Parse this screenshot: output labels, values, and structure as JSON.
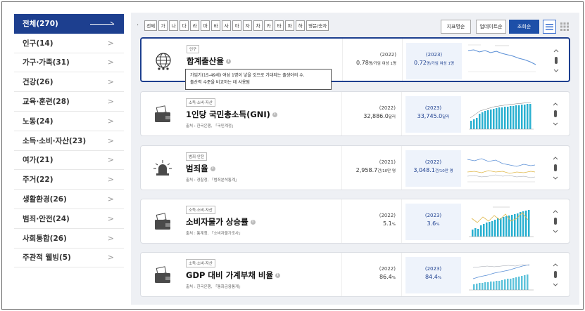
{
  "sidebar": {
    "items": [
      {
        "label": "전체(270)",
        "active": true
      },
      {
        "label": "인구(14)"
      },
      {
        "label": "가구·가족(31)"
      },
      {
        "label": "건강(26)"
      },
      {
        "label": "교육·훈련(28)"
      },
      {
        "label": "노동(24)"
      },
      {
        "label": "소득·소비·자산(23)"
      },
      {
        "label": "여가(21)"
      },
      {
        "label": "주거(22)"
      },
      {
        "label": "생활환경(26)"
      },
      {
        "label": "범죄·안전(24)"
      },
      {
        "label": "사회통합(26)"
      },
      {
        "label": "주관적 웰빙(5)"
      }
    ]
  },
  "filter": {
    "dot": "·",
    "keys": [
      "전체",
      "가",
      "나",
      "다",
      "라",
      "마",
      "바",
      "사",
      "아",
      "자",
      "차",
      "카",
      "타",
      "파",
      "하",
      "영문/숫자"
    ]
  },
  "sort": {
    "buttons": [
      "지표명순",
      "업데이트순",
      "조회순"
    ],
    "selected": "조회순"
  },
  "colors": {
    "accent": "#1d3f8f",
    "chart_line": "#5a8fd6",
    "bar": "#2ab0d0",
    "bar_accent": "#e0b84a"
  },
  "cards": [
    {
      "tag": "인구",
      "title": "합계출산율",
      "source": "",
      "icon": "population-globe-icon",
      "prev_year": "(2022)",
      "prev_value": "0.78",
      "prev_unit": "명/가임 여성 1명",
      "cur_year": "(2023)",
      "cur_value": "0.72",
      "cur_unit": "명/가임 여성 1명",
      "tooltip_line1": "가임기(15-49세) 여성 1명이 낳을 것으로 기대되는 출생아의 수.",
      "tooltip_line2": "출산력 수준을 비교하는 데 사용됨"
    },
    {
      "tag": "소득·소비·자산",
      "title": "1인당 국민총소득(GNI)",
      "source": "출처 : 한국은행, 「국민계정」",
      "icon": "wallet-icon",
      "prev_year": "(2022)",
      "prev_value": "32,886.0",
      "prev_unit": "달러",
      "cur_year": "(2023)",
      "cur_value": "33,745.0",
      "cur_unit": "달러"
    },
    {
      "tag": "범죄·안전",
      "title": "범죄율",
      "source": "출처 : 경찰청, 「범죄분석통계」",
      "icon": "siren-icon",
      "prev_year": "(2021)",
      "prev_value": "2,958.7",
      "prev_unit": "건/10만 명",
      "cur_year": "(2022)",
      "cur_value": "3,048.1",
      "cur_unit": "건/10만 명"
    },
    {
      "tag": "소득·소비·자산",
      "title": "소비자물가 상승률",
      "source": "출처 : 통계청, 「소비자물가조사」",
      "icon": "wallet-icon",
      "prev_year": "(2022)",
      "prev_value": "5.1",
      "prev_unit": "%",
      "cur_year": "(2023)",
      "cur_value": "3.6",
      "cur_unit": "%"
    },
    {
      "tag": "소득·소비·자산",
      "title": "GDP 대비 가계부채 비율",
      "source": "출처 : 한국은행, 「통화금융통계」",
      "icon": "wallet-icon",
      "prev_year": "(2022)",
      "prev_value": "86.4",
      "prev_unit": "%",
      "cur_year": "(2023)",
      "cur_value": "84.4",
      "cur_unit": "%"
    }
  ]
}
